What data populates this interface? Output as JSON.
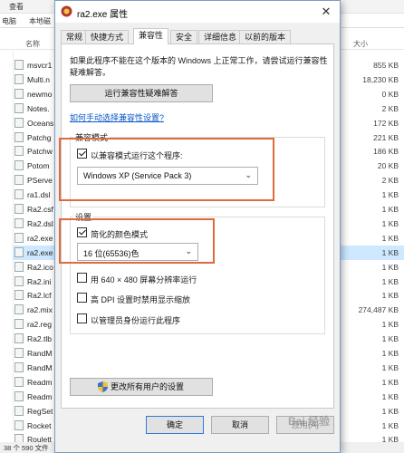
{
  "explorer": {
    "toolbar_label": "查看",
    "breadcrumb": [
      "电脑",
      "本地磁"
    ],
    "columns": {
      "name": "名称",
      "size": "大小"
    },
    "files": [
      {
        "name": "msvcr1",
        "size": "855 KB"
      },
      {
        "name": "Multi.n",
        "size": "18,230 KB"
      },
      {
        "name": "newmo",
        "size": "0 KB"
      },
      {
        "name": "Notes.",
        "size": "2 KB"
      },
      {
        "name": "Oceans",
        "size": "172 KB"
      },
      {
        "name": "Patchg",
        "size": "221 KB"
      },
      {
        "name": "Patchw",
        "size": "186 KB"
      },
      {
        "name": "Potom",
        "size": "20 KB"
      },
      {
        "name": "PServe",
        "size": "2 KB"
      },
      {
        "name": "ra1.dsl",
        "size": "1 KB"
      },
      {
        "name": "Ra2.csf",
        "size": "1 KB"
      },
      {
        "name": "Ra2.dsl",
        "size": "1 KB"
      },
      {
        "name": "ra2.exe",
        "size": "1 KB"
      },
      {
        "name": "ra2.exe",
        "size": "1 KB"
      },
      {
        "name": "Ra2.ico",
        "size": "1 KB"
      },
      {
        "name": "Ra2.ini",
        "size": "1 KB"
      },
      {
        "name": "Ra2.lcf",
        "size": "1 KB"
      },
      {
        "name": "ra2.mix",
        "size": "274,487 KB"
      },
      {
        "name": "ra2.reg",
        "size": "1 KB"
      },
      {
        "name": "Ra2.tlb",
        "size": "1 KB"
      },
      {
        "name": "RandM",
        "size": "1 KB"
      },
      {
        "name": "RandM",
        "size": "1 KB"
      },
      {
        "name": "Readm",
        "size": "1 KB"
      },
      {
        "name": "Readm",
        "size": "1 KB"
      },
      {
        "name": "RegSet",
        "size": "1 KB"
      },
      {
        "name": "Rocket",
        "size": "1 KB"
      },
      {
        "name": "Roulett",
        "size": "1 KB"
      }
    ],
    "status": "38 个 590 文件"
  },
  "dialog": {
    "title": "ra2.exe 属性",
    "close_glyph": "✕",
    "tabs": [
      "常规",
      "快捷方式",
      "兼容性",
      "安全",
      "详细信息",
      "以前的版本"
    ],
    "active_tab": 2,
    "intro_text": "如果此程序不能在这个版本的 Windows 上正常工作，请尝试运行兼容性疑难解答。",
    "troubleshoot_button": "运行兼容性疑难解答",
    "manual_link": "如何手动选择兼容性设置?",
    "compat_group_label": "兼容模式",
    "compat_checkbox_label": "以兼容模式运行这个程序:",
    "compat_select_value": "Windows XP (Service Pack 3)",
    "settings_group_label": "设置",
    "reduced_color_label": "简化的颜色模式",
    "color_select_value": "16 位(65536)色",
    "res_640_label": "用 640 × 480 屏幕分辨率运行",
    "high_dpi_label": "高 DPI 设置时禁用显示缩放",
    "admin_label": "以管理员身份运行此程序",
    "all_users_button": "更改所有用户的设置",
    "ok_button": "确定",
    "cancel_button": "取消",
    "apply_button": "应用(A)",
    "checks": {
      "compat": true,
      "reduced_color": true,
      "res_640": false,
      "high_dpi": false,
      "admin": false
    }
  },
  "watermark": "Bai 经验",
  "colors": {
    "highlight": "#e06a3b",
    "link": "#0b56c9",
    "selection": "#cde8ff"
  }
}
